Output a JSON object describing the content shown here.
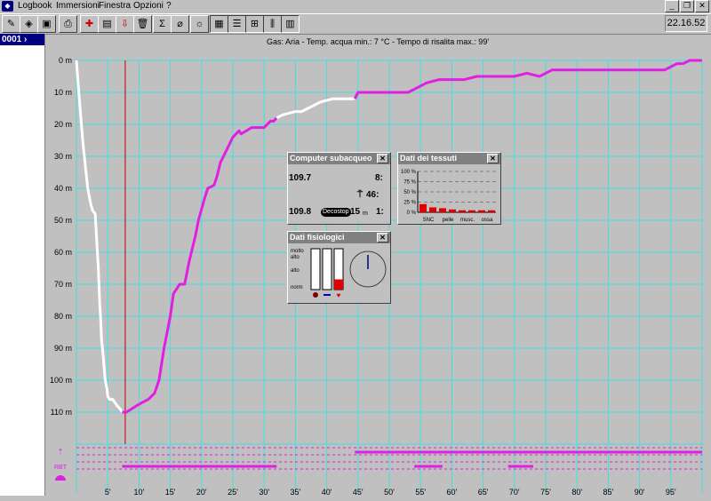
{
  "menubar": {
    "items": [
      "Logbook",
      "Immersioni",
      "Finestra",
      "Opzioni",
      "?"
    ]
  },
  "clock": "22.16.52",
  "dive_list": {
    "selected": "0001"
  },
  "info_line": "Gas: Aria  -  Temp. acqua min.: 7 °C  -  Tempo di risalita max.: 99'",
  "colors": {
    "profile_ascent": "#e020e0",
    "profile_descent": "#ffffff",
    "grid": "#40e0e0",
    "marker": "#c00000"
  },
  "chart_data": {
    "type": "line",
    "xlabel": "",
    "ylabel": "",
    "xlim": [
      0,
      100
    ],
    "ylim": [
      0,
      120
    ],
    "x_ticks": [
      "5'",
      "10'",
      "15'",
      "20'",
      "25'",
      "30'",
      "35'",
      "40'",
      "45'",
      "50'",
      "55'",
      "60'",
      "65'",
      "70'",
      "75'",
      "80'",
      "85'",
      "90'",
      "95'"
    ],
    "y_ticks": [
      "0 m",
      "10 m",
      "20 m",
      "30 m",
      "40 m",
      "50 m",
      "60 m",
      "70 m",
      "80 m",
      "90 m",
      "100 m",
      "110 m"
    ],
    "grid": true,
    "series": [
      {
        "color": "#ffffff",
        "x": [
          0,
          0.3,
          1,
          1.8,
          2.3,
          2.6,
          3,
          3.5,
          3.7,
          3.9,
          4,
          4.3,
          4.6,
          4.9,
          5,
          5.3,
          5.8,
          6.5,
          7,
          7.3
        ],
        "y": [
          0,
          8,
          25,
          40,
          45,
          47,
          48,
          65,
          75,
          82,
          87,
          93,
          100,
          103,
          105,
          106,
          106,
          108,
          109,
          110
        ]
      },
      {
        "color": "#e020e0",
        "x": [
          7.3,
          8,
          8.8,
          9.6,
          10.5,
          11.5,
          12.5,
          13.2,
          14,
          15,
          15.5,
          16.5,
          17.3,
          18,
          19,
          19.5,
          20.5,
          21,
          22,
          22.5,
          23,
          24,
          24.5,
          25,
          26,
          26.3,
          28,
          30,
          31,
          31.5,
          32
        ],
        "y": [
          110,
          110,
          109,
          108,
          107,
          106,
          104,
          100,
          90,
          80,
          73,
          70,
          70,
          63,
          55,
          50,
          43,
          40,
          39,
          36,
          32,
          28,
          26,
          24,
          22,
          23,
          21,
          21,
          19,
          19,
          18
        ]
      },
      {
        "color": "#ffffff",
        "x": [
          32,
          33,
          35,
          36,
          37,
          38,
          39,
          41,
          42,
          43,
          44.5
        ],
        "y": [
          18,
          17,
          16,
          16,
          15,
          14,
          13,
          12,
          12,
          12,
          12
        ]
      },
      {
        "color": "#e020e0",
        "x": [
          44.5,
          45,
          46,
          48,
          50,
          52,
          53,
          54,
          55,
          56,
          58,
          60,
          62,
          64,
          66,
          68,
          70,
          72,
          74,
          75,
          76,
          78,
          80,
          82,
          84,
          86,
          88,
          90,
          92,
          94,
          96,
          97,
          98,
          100
        ],
        "y": [
          12,
          10,
          10,
          10,
          10,
          10,
          10,
          9,
          8,
          7,
          6,
          6,
          6,
          5,
          5,
          5,
          5,
          4,
          5,
          4,
          3,
          3,
          3,
          3,
          3,
          3,
          3,
          3,
          3,
          3,
          1,
          1,
          0,
          0
        ]
      }
    ],
    "marker_x": 7.8
  },
  "events": {
    "rbt_label": "RBT"
  },
  "dive_computer": {
    "title": "Computer subacqueo",
    "val1": "109.7",
    "val2": "8:",
    "val3": "46:",
    "val4": "109.8",
    "badge": "Decostop",
    "deco_depth": "15",
    "deco_unit": "m",
    "val5": "1:"
  },
  "tissue": {
    "title": "Dati dei tessuti",
    "y_labels": [
      "100 %",
      "75 %",
      "50 %",
      "25 %",
      "0 %"
    ],
    "x_labels": [
      "SNC",
      "pelle",
      "musc.",
      "ossa"
    ],
    "values": [
      20,
      12,
      10,
      7,
      5,
      5,
      5,
      5
    ]
  },
  "physio": {
    "title": "Dati fisiologici",
    "labels": [
      "molto",
      "alto",
      "alto",
      "norm"
    ],
    "bar_levels": [
      0,
      0,
      0.25
    ]
  }
}
